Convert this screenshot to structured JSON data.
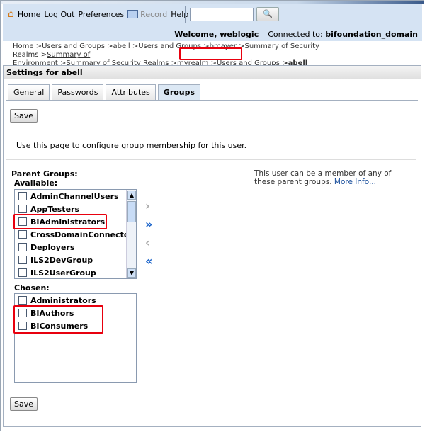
{
  "header": {
    "nav": [
      {
        "label": "Home",
        "icon": "home-icon"
      },
      {
        "label": "Log Out"
      },
      {
        "label": "Preferences"
      },
      {
        "label": "Record",
        "icon": "record-icon",
        "disabled": true
      },
      {
        "label": "Help"
      }
    ],
    "search_value": "",
    "welcome": "Welcome, weblogic",
    "connected_label": "Connected to:",
    "domain": "bifoundation_domain"
  },
  "breadcrumb": {
    "line1": "Home >Users and Groups >abell >Users and Groups >bmayer >Summary of Security Realms >",
    "line1_link": "Summary of",
    "line2_link": "Environment",
    "line2": " >Summary of Security Realms >myrealm ",
    "highlighted": ">Users and Groups",
    "current": " >abell"
  },
  "panel": {
    "title": "Settings for abell",
    "tabs": [
      {
        "label": "General"
      },
      {
        "label": "Passwords"
      },
      {
        "label": "Attributes"
      },
      {
        "label": "Groups",
        "active": true
      }
    ],
    "save_label": "Save",
    "description": "Use this page to configure group membership for this user.",
    "parent_groups_label": "Parent Groups:",
    "available_label": "Available:",
    "available": [
      "AdminChannelUsers",
      "AppTesters",
      "BIAdministrators",
      "CrossDomainConnectors",
      "Deployers",
      "ILS2DevGroup",
      "ILS2UserGroup"
    ],
    "chosen_label": "Chosen:",
    "chosen": [
      "Administrators",
      "BIAuthors",
      "BIConsumers"
    ],
    "help_text": "This user can be a member of any of these parent groups.",
    "more_info": "More Info..."
  },
  "colors": {
    "highlight": "#e8000e",
    "header_bg": "#d5e3f3",
    "arrow_blue": "#1a63c9"
  }
}
